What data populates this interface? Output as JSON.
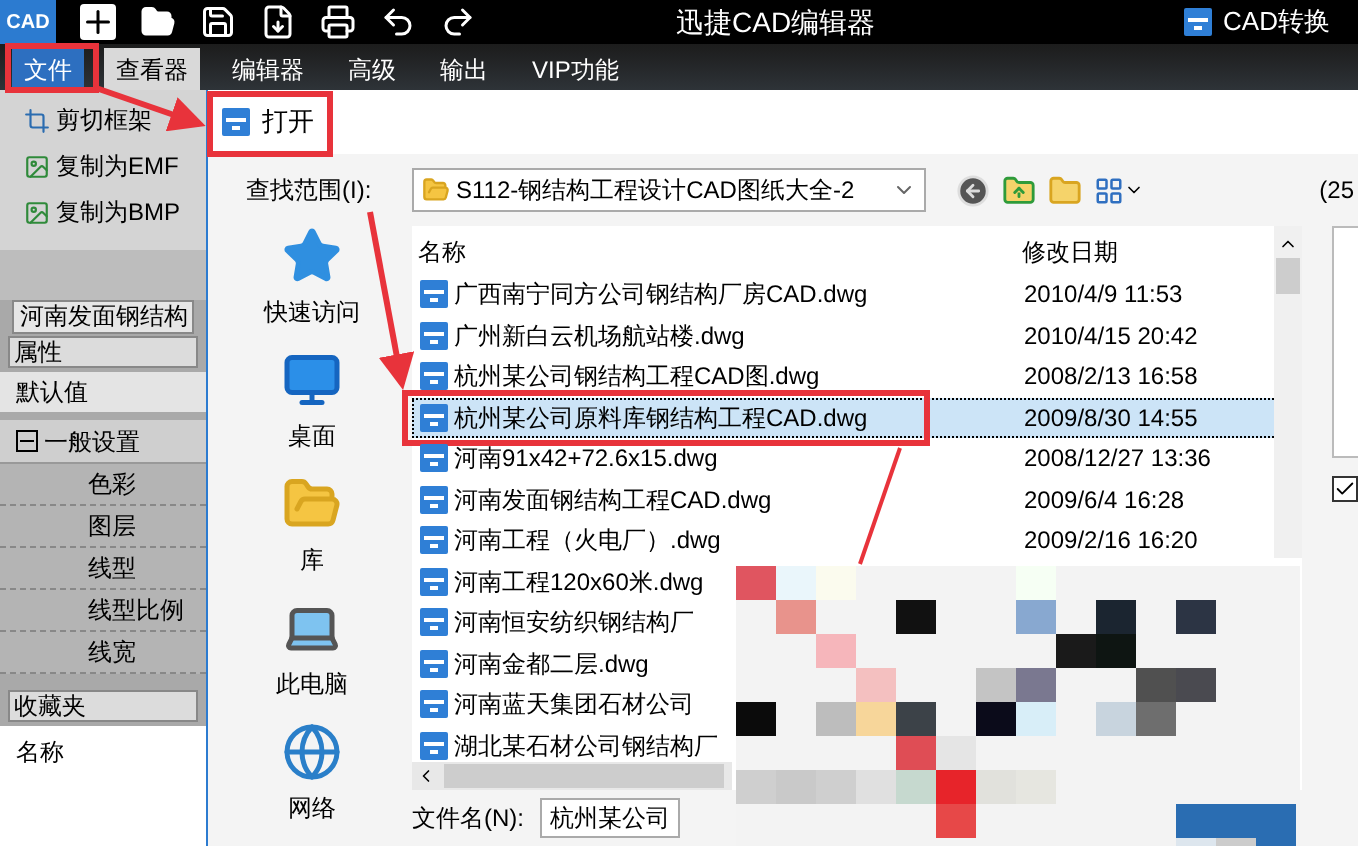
{
  "app_bar": {
    "logo_text": "CAD",
    "title": "迅捷CAD编辑器",
    "convert_label": "CAD转换"
  },
  "menu": [
    {
      "label": "文件",
      "selected": true,
      "active": false
    },
    {
      "label": "查看器",
      "selected": false,
      "active": true
    },
    {
      "label": "编辑器",
      "selected": false,
      "active": false
    },
    {
      "label": "高级",
      "selected": false,
      "active": false
    },
    {
      "label": "输出",
      "selected": false,
      "active": false
    },
    {
      "label": "VIP功能",
      "selected": false,
      "active": false
    }
  ],
  "side_panel": {
    "tools": [
      {
        "label": "剪切框架",
        "kind": "crop"
      },
      {
        "label": "复制为EMF",
        "kind": "emf"
      },
      {
        "label": "复制为BMP",
        "kind": "bmp"
      }
    ],
    "document_tab": "河南发面钢结构",
    "properties": {
      "title": "属性",
      "default_row": "默认值",
      "group": {
        "label": "一般设置",
        "expanded": true,
        "children": [
          "色彩",
          "图层",
          "线型",
          "线型比例",
          "线宽"
        ]
      }
    },
    "favorites": {
      "title": "收藏夹",
      "column": "名称"
    }
  },
  "dialog": {
    "title": "打开",
    "look_in_label": "查找范围(I):",
    "look_in_value": "S112-钢结构工程设计CAD图纸大全-2",
    "count_text": "(25",
    "places": [
      {
        "label": "快速访问",
        "kind": "quick"
      },
      {
        "label": "桌面",
        "kind": "desktop"
      },
      {
        "label": "库",
        "kind": "library"
      },
      {
        "label": "此电脑",
        "kind": "pc"
      },
      {
        "label": "网络",
        "kind": "network"
      }
    ],
    "columns": [
      "名称",
      "修改日期"
    ],
    "files": [
      {
        "name": "广西南宁同方公司钢结构厂房CAD.dwg",
        "modified": "2010/4/9 11:53",
        "selected": false
      },
      {
        "name": "广州新白云机场航站楼.dwg",
        "modified": "2010/4/15 20:42",
        "selected": false
      },
      {
        "name": "杭州某公司钢结构工程CAD图.dwg",
        "modified": "2008/2/13 16:58",
        "selected": false
      },
      {
        "name": "杭州某公司原料库钢结构工程CAD.dwg",
        "modified": "2009/8/30 14:55",
        "selected": true
      },
      {
        "name": "河南91x42+72.6x15.dwg",
        "modified": "2008/12/27 13:36",
        "selected": false
      },
      {
        "name": "河南发面钢结构工程CAD.dwg",
        "modified": "2009/6/4 16:28",
        "selected": false
      },
      {
        "name": "河南工程（火电厂）.dwg",
        "modified": "2009/2/16 16:20",
        "selected": false
      },
      {
        "name": "河南工程120x60米.dwg",
        "selected": false
      },
      {
        "name": "河南恒安纺织钢结构厂",
        "selected": false
      },
      {
        "name": "河南金都二层.dwg",
        "selected": false
      },
      {
        "name": "河南蓝天集团石材公司",
        "selected": false
      },
      {
        "name": "湖北某石材公司钢结构厂",
        "selected": false
      }
    ],
    "file_name_label": "文件名(N):",
    "file_name_value": "杭州某公司",
    "preview_option": {
      "checked": true
    }
  }
}
